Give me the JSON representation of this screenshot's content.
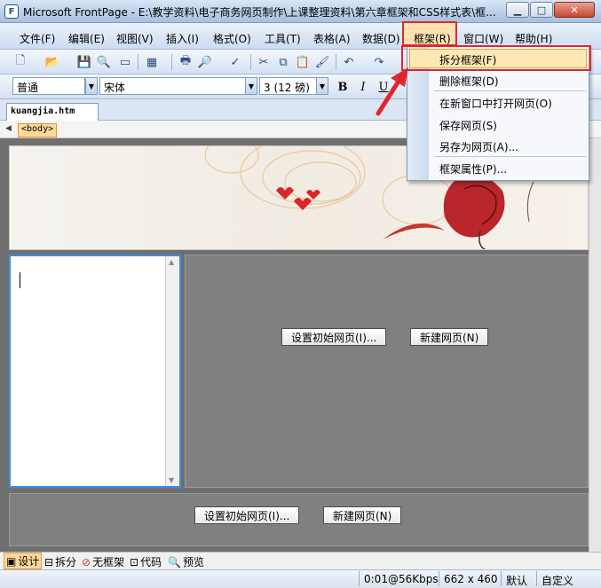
{
  "window": {
    "title": "Microsoft FrontPage - E:\\教学资料\\电子商务网页制作\\上课整理资料\\第六章框架和CSS样式表\\框...",
    "minimize": "0",
    "maximize": "□",
    "close": "✕"
  },
  "menubar": {
    "items": [
      {
        "label": "文件(F)"
      },
      {
        "label": "编辑(E)"
      },
      {
        "label": "视图(V)"
      },
      {
        "label": "插入(I)"
      },
      {
        "label": "格式(O)"
      },
      {
        "label": "工具(T)"
      },
      {
        "label": "表格(A)"
      },
      {
        "label": "数据(D)"
      },
      {
        "label": "框架(R)"
      },
      {
        "label": "窗口(W)"
      },
      {
        "label": "帮助(H)"
      }
    ]
  },
  "format_toolbar": {
    "style_value": "普通",
    "font_value": "宋体",
    "size_value": "3 (12 磅)",
    "bold": "B",
    "italic": "I",
    "underline": "U"
  },
  "document": {
    "tab_name": "kuangjia.htm",
    "tag": "<body>"
  },
  "frames": {
    "set_initial_page": "设置初始网页(I)...",
    "new_page": "新建网页(N)"
  },
  "frame_menu": {
    "items": [
      {
        "label": "拆分框架(F)"
      },
      {
        "label": "删除框架(D)"
      },
      {
        "label": "在新窗口中打开网页(O)"
      },
      {
        "label": "保存网页(S)"
      },
      {
        "label": "另存为网页(A)..."
      },
      {
        "label": "框架属性(P)..."
      }
    ]
  },
  "view_tabs": {
    "design": "设计",
    "split": "拆分",
    "no_frames": "无框架",
    "code": "代码",
    "preview": "预览"
  },
  "statusbar": {
    "speed": "0:01@56Kbps",
    "size": "662 x 460",
    "mode": "默认",
    "custom": "自定义"
  },
  "colors": {
    "annotation_red": "#e0262a",
    "selection_frame": "#3a8ee8",
    "menu_highlight": "#fde7b3"
  }
}
